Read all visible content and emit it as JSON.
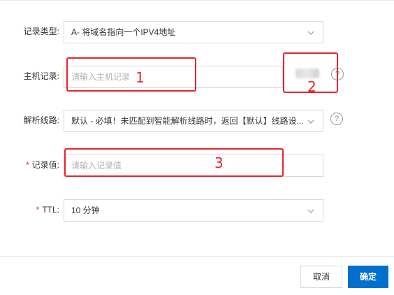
{
  "form": {
    "record_type": {
      "label": "记录类型:",
      "value": "A- 将域名指向一个IPV4地址"
    },
    "host_record": {
      "label": "主机记录:",
      "placeholder": "请输入主机记录",
      "suffix_help": "?"
    },
    "line": {
      "label": "解析线路:",
      "value": "默认 - 必填！未匹配到智能解析线路时，返回【默认】线路设...",
      "help": "?"
    },
    "record_value": {
      "required_mark": "*",
      "label": "记录值:",
      "placeholder": "请输入记录值"
    },
    "ttl": {
      "required_mark": "*",
      "label": "TTL:",
      "value": "10 分钟"
    }
  },
  "annotations": {
    "box1_label": "1",
    "box2_label": "2",
    "box3_label": "3",
    "color": "#e8242c"
  },
  "footer": {
    "cancel_label": "取消",
    "ok_label": "确定"
  },
  "colors": {
    "primary": "#0070cc",
    "required": "#e62a10"
  },
  "icons": [
    "chevron-down-icon",
    "help-icon"
  ]
}
